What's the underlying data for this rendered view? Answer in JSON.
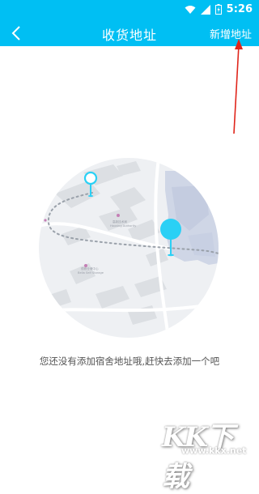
{
  "status_bar": {
    "time": "5:26"
  },
  "header": {
    "title": "收货地址",
    "add_address_label": "新增地址"
  },
  "illustration": {
    "map_labels": {
      "housing_cn": "高新技术局",
      "housing_en": "Housing Authority",
      "storage_cn": "德雅仓储中心",
      "storage_en": "Bella Self Storage",
      "road": "Ma"
    }
  },
  "empty_state": {
    "message": "您还没有添加宿舍地址哦,赶快去添加一个吧"
  },
  "watermark": {
    "logo": "KK下载",
    "url": "www.kkx.net"
  },
  "colors": {
    "accent": "#00bff3",
    "pin": "#2ad0f5",
    "arrow": "#e0251b"
  }
}
